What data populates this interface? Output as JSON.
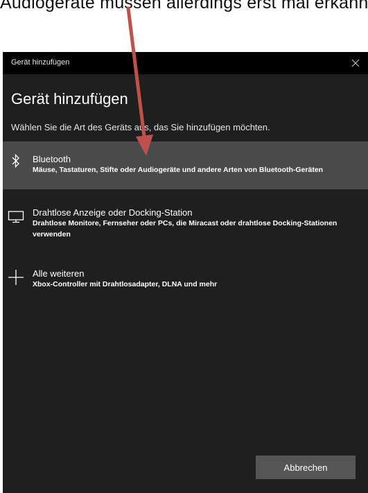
{
  "caption": "Audiogeräte müssen allerdings erst mal erkannt werden",
  "window": {
    "title": "Gerät hinzufügen"
  },
  "dialog": {
    "heading": "Gerät hinzufügen",
    "subtitle": "Wählen Sie die Art des Geräts aus, das Sie hinzufügen möchten.",
    "options": [
      {
        "label": "Bluetooth",
        "description": "Mäuse, Tastaturen, Stifte oder Audiogeräte und andere Arten von Bluetooth-Geräten",
        "icon": "bluetooth-icon",
        "selected": true
      },
      {
        "label": "Drahtlose Anzeige oder Docking-Station",
        "description": "Drahtlose Monitore, Fernseher oder PCs, die Miracast oder drahtlose Docking-Stationen verwenden",
        "icon": "monitor-icon",
        "selected": false
      },
      {
        "label": "Alle weiteren",
        "description": "Xbox-Controller mit Drahtlosadapter, DLNA und mehr",
        "icon": "plus-icon",
        "selected": false
      }
    ],
    "cancel_label": "Abbrechen"
  },
  "colors": {
    "dialog_bg": "#1f1f1f",
    "titlebar_bg": "#000000",
    "selected_row": "#4a4a4a",
    "arrow": "#c0504d"
  }
}
